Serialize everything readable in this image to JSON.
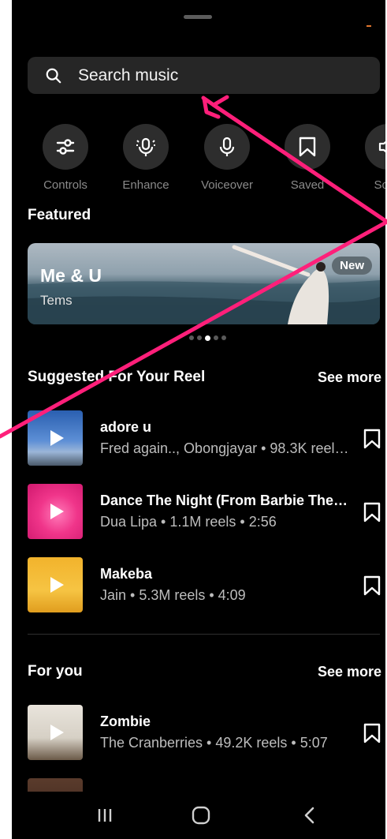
{
  "search": {
    "placeholder": "Search music"
  },
  "tools": [
    {
      "label": "Controls",
      "icon": "sliders-icon"
    },
    {
      "label": "Enhance",
      "icon": "enhance-mic-icon"
    },
    {
      "label": "Voiceover",
      "icon": "microphone-icon"
    },
    {
      "label": "Saved",
      "icon": "bookmark-icon"
    },
    {
      "label": "Soun",
      "icon": "speaker-icon"
    }
  ],
  "featured": {
    "section_title": "Featured",
    "card": {
      "title": "Me & U",
      "artist": "Tems",
      "badge": "New"
    },
    "page_count": 5,
    "active_page": 2
  },
  "suggested": {
    "section_title": "Suggested For Your Reel",
    "see_more": "See more",
    "tracks": [
      {
        "title": "adore u",
        "meta": "Fred again.., Obongjayar • 98.3K reel…"
      },
      {
        "title": "Dance The Night (From Barbie The…",
        "meta": "Dua Lipa • 1.1M reels • 2:56"
      },
      {
        "title": "Makeba",
        "meta": "Jain • 5.3M reels • 4:09"
      }
    ]
  },
  "for_you": {
    "section_title": "For you",
    "see_more": "See more",
    "tracks": [
      {
        "title": "Zombie",
        "meta": "The Cranberries • 49.2K reels • 5:07"
      }
    ]
  },
  "colors": {
    "annotation_arrow": "#ff1f7a",
    "background": "#000000",
    "accent_dash": "#e0762e"
  }
}
